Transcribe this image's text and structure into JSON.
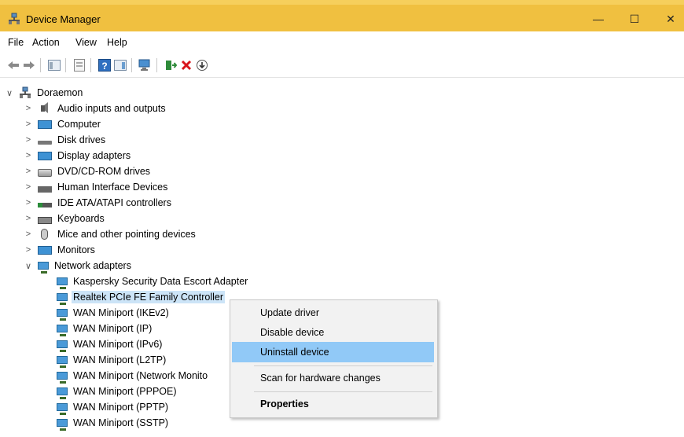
{
  "window": {
    "title": "Device Manager",
    "min_glyph": "—",
    "max_glyph": "☐",
    "close_glyph": "✕",
    "accent": "#f0c040"
  },
  "menu": [
    "File",
    "Action",
    "View",
    "Help"
  ],
  "toolbar": {
    "icons": [
      "back-icon",
      "forward-icon",
      "show-hide-console-tree-icon",
      "properties-icon",
      "help-icon",
      "action-pane-icon",
      "scan-hardware-icon",
      "update-driver-icon",
      "uninstall-icon",
      "download-icon"
    ]
  },
  "tree": {
    "root": {
      "label": "Doraemon",
      "chevron": "∨"
    },
    "categories": [
      {
        "label": "Audio inputs and outputs",
        "chevron": ">",
        "icon": "speaker-icon"
      },
      {
        "label": "Computer",
        "chevron": ">",
        "icon": "computer-icon"
      },
      {
        "label": "Disk drives",
        "chevron": ">",
        "icon": "disk-drive-icon"
      },
      {
        "label": "Display adapters",
        "chevron": ">",
        "icon": "display-adapter-icon"
      },
      {
        "label": "DVD/CD-ROM drives",
        "chevron": ">",
        "icon": "dvd-drive-icon"
      },
      {
        "label": "Human Interface Devices",
        "chevron": ">",
        "icon": "hid-icon"
      },
      {
        "label": "IDE ATA/ATAPI controllers",
        "chevron": ">",
        "icon": "ide-controller-icon"
      },
      {
        "label": "Keyboards",
        "chevron": ">",
        "icon": "keyboard-icon"
      },
      {
        "label": "Mice and other pointing devices",
        "chevron": ">",
        "icon": "mouse-icon"
      },
      {
        "label": "Monitors",
        "chevron": ">",
        "icon": "monitor-icon"
      },
      {
        "label": "Network adapters",
        "chevron": "∨",
        "icon": "network-adapter-icon"
      }
    ],
    "network_children": [
      "Kaspersky Security Data Escort Adapter",
      "Realtek PCIe FE Family Controller",
      "WAN Miniport (IKEv2)",
      "WAN Miniport (IP)",
      "WAN Miniport (IPv6)",
      "WAN Miniport (L2TP)",
      "WAN Miniport (Network Monito",
      "WAN Miniport (PPPOE)",
      "WAN Miniport (PPTP)",
      "WAN Miniport (SSTP)"
    ],
    "selected_child": "Realtek PCIe FE Family Controller",
    "selection_color": "#cce4f7"
  },
  "context_menu": {
    "items": [
      {
        "label": "Update driver"
      },
      {
        "label": "Disable device"
      },
      {
        "label": "Uninstall device",
        "highlighted": true
      },
      {
        "label": "Scan for hardware changes"
      },
      {
        "label": "Properties",
        "bold": true
      }
    ],
    "highlight_color": "#91c9f7"
  }
}
